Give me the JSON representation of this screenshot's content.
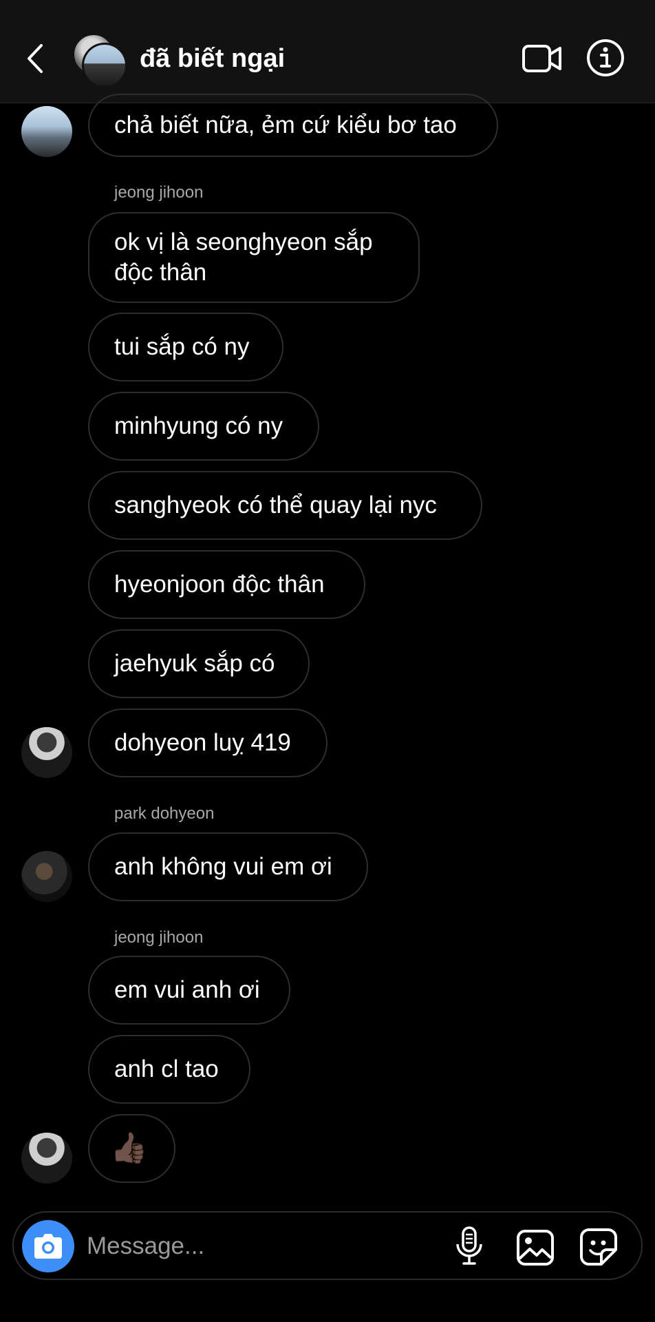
{
  "header": {
    "title": "đã biết ngại"
  },
  "messages": [
    {
      "text": "chả biết nữa, ẻm cứ kiểu bơ tao"
    },
    {
      "text": "ok vị là seonghyeon sắp độc thân"
    },
    {
      "text": "tui sắp có ny"
    },
    {
      "text": "minhyung có ny"
    },
    {
      "text": "sanghyeok có thể quay lại nyc"
    },
    {
      "text": "hyeonjoon độc thân"
    },
    {
      "text": "jaehyuk sắp có"
    },
    {
      "text": "dohyeon luỵ 419"
    },
    {
      "text": "anh không vui em ơi"
    },
    {
      "text": "em vui anh ơi"
    },
    {
      "text": "anh cl tao"
    },
    {
      "text": "👍🏿"
    }
  ],
  "senders": {
    "s1": "jeong jihoon",
    "s2": "park dohyeon",
    "s3": "jeong jihoon"
  },
  "composer": {
    "placeholder": "Message..."
  },
  "colors": {
    "accent": "#3d8ff7",
    "header_bg": "#121212",
    "bubble_border": "#2e2e2e"
  },
  "icons": [
    "back-icon",
    "video-call-icon",
    "info-icon",
    "camera-icon",
    "microphone-icon",
    "gallery-icon",
    "sticker-icon"
  ]
}
